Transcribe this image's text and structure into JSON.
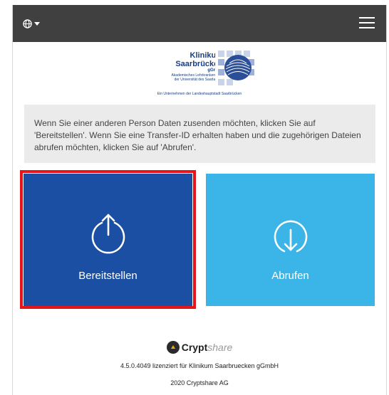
{
  "header": {
    "language_icon": "globe-icon",
    "menu_icon": "hamburger-menu-icon"
  },
  "logo": {
    "name_line1": "Klinikum",
    "name_line2": "Saarbrücken",
    "name_line3": "gGmbH",
    "sub_line1": "Akademisches Lehrkrankenhaus",
    "sub_line2": "der Universität des Saarlandes",
    "tagline": "Ein Unternehmen der Landeshauptstadt Saarbrücken"
  },
  "info": {
    "text": "Wenn Sie einer anderen Person Daten zusenden möchten, klicken Sie auf 'Bereitstellen'. Wenn Sie eine Transfer-ID erhalten haben und die zugehörigen Dateien abrufen möchten, klicken Sie auf 'Abrufen'."
  },
  "tiles": {
    "upload_label": "Bereitstellen",
    "upload_icon": "upload-icon",
    "download_label": "Abrufen",
    "download_icon": "download-icon"
  },
  "footer": {
    "brand_strong": "Crypt",
    "brand_light": "share",
    "license": "4.5.0.4049 lizenziert für Klinikum Saarbruecken gGmbH",
    "copyright": "2020 Cryptshare AG"
  },
  "colors": {
    "topbar": "#404040",
    "upload_tile": "#1a4fa3",
    "download_tile": "#3bb5e8",
    "highlight": "#e8141c"
  }
}
